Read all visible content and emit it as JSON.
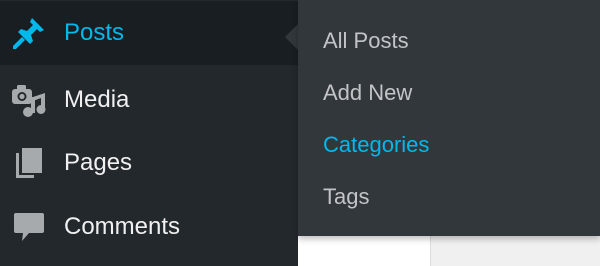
{
  "admin_menu": {
    "items": [
      {
        "label": "Posts",
        "icon": "pushpin-icon",
        "current": true
      },
      {
        "label": "Media",
        "icon": "media-icon",
        "current": false
      },
      {
        "label": "Pages",
        "icon": "pages-icon",
        "current": false
      },
      {
        "label": "Comments",
        "icon": "comment-bubble-icon",
        "current": false
      }
    ]
  },
  "submenu": {
    "items": [
      {
        "label": "All Posts",
        "active": false
      },
      {
        "label": "Add New",
        "active": false
      },
      {
        "label": "Categories",
        "active": true
      },
      {
        "label": "Tags",
        "active": false
      }
    ]
  },
  "colors": {
    "menu_bg": "#23282d",
    "current_bg": "#191e23",
    "flyout_bg": "#32373c",
    "accent": "#00b9eb",
    "text": "#f0f0f1",
    "sub_text": "#c3c4c7",
    "icon": "#a7aaad"
  }
}
